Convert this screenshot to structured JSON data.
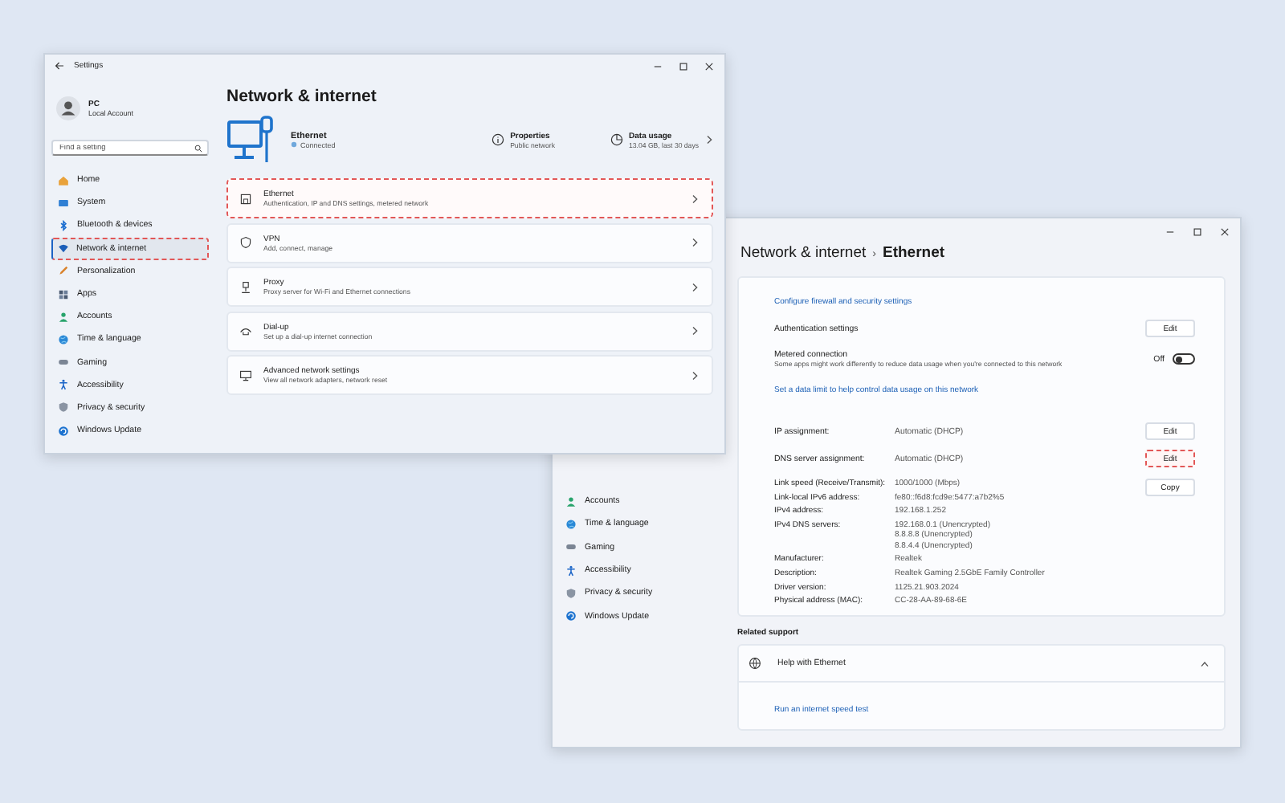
{
  "settings_window": {
    "title": "Settings",
    "user": {
      "name": "PC",
      "account": "Local Account"
    },
    "search": {
      "placeholder": "Find a setting"
    },
    "nav": [
      {
        "label": "Home",
        "selected": false,
        "highlighted": false
      },
      {
        "label": "System",
        "selected": false,
        "highlighted": false
      },
      {
        "label": "Bluetooth & devices",
        "selected": false,
        "highlighted": false
      },
      {
        "label": "Network & internet",
        "selected": true,
        "highlighted": true
      },
      {
        "label": "Personalization",
        "selected": false,
        "highlighted": false
      },
      {
        "label": "Apps",
        "selected": false,
        "highlighted": false
      },
      {
        "label": "Accounts",
        "selected": false,
        "highlighted": false
      },
      {
        "label": "Time & language",
        "selected": false,
        "highlighted": false
      },
      {
        "label": "Gaming",
        "selected": false,
        "highlighted": false
      },
      {
        "label": "Accessibility",
        "selected": false,
        "highlighted": false
      },
      {
        "label": "Privacy & security",
        "selected": false,
        "highlighted": false
      },
      {
        "label": "Windows Update",
        "selected": false,
        "highlighted": false
      }
    ],
    "heading": "Network & internet",
    "connection": {
      "name": "Ethernet",
      "state": "Connected"
    },
    "properties": {
      "title": "Properties",
      "value": "Public network"
    },
    "data_usage": {
      "title": "Data usage",
      "value": "13.04 GB, last 30 days"
    },
    "items": [
      {
        "title": "Ethernet",
        "subtitle": "Authentication, IP and DNS settings, metered network",
        "highlighted": true
      },
      {
        "title": "VPN",
        "subtitle": "Add, connect, manage",
        "highlighted": false
      },
      {
        "title": "Proxy",
        "subtitle": "Proxy server for Wi-Fi and Ethernet connections",
        "highlighted": false
      },
      {
        "title": "Dial-up",
        "subtitle": "Set up a dial-up internet connection",
        "highlighted": false
      },
      {
        "title": "Advanced network settings",
        "subtitle": "View all network adapters, network reset",
        "highlighted": false
      }
    ]
  },
  "ethernet_window": {
    "breadcrumb": {
      "parent": "Network & internet",
      "separator": "›",
      "current": "Ethernet"
    },
    "nav": [
      {
        "label": "Accounts",
        "selected": false
      },
      {
        "label": "Time & language",
        "selected": false
      },
      {
        "label": "Gaming",
        "selected": false
      },
      {
        "label": "Accessibility",
        "selected": false
      },
      {
        "label": "Privacy & security",
        "selected": false
      },
      {
        "label": "Windows Update",
        "selected": false
      }
    ],
    "rows": [
      {
        "kind": "link",
        "text": "Configure firewall and security settings"
      },
      {
        "kind": "button",
        "label": "Authentication settings",
        "button": "Edit",
        "highlighted": false
      },
      {
        "kind": "toggle",
        "label": "Metered connection",
        "description": "Some apps might work differently to reduce data usage when you're connected to this network",
        "state_text": "Off",
        "on": false
      },
      {
        "kind": "link",
        "text": "Set a data limit to help control data usage on this network"
      },
      {
        "kind": "value",
        "label": "IP assignment:",
        "value": "Automatic (DHCP)",
        "button": "Edit",
        "highlighted": false
      },
      {
        "kind": "value",
        "label": "DNS server assignment:",
        "value": "Automatic (DHCP)",
        "button": "Edit",
        "highlighted": true
      }
    ],
    "copy_button": "Copy",
    "details": [
      {
        "label": "Link speed (Receive/Transmit):",
        "values": [
          "1000/1000 (Mbps)"
        ]
      },
      {
        "label": "Link-local IPv6 address:",
        "values": [
          "fe80::f6d8:fcd9e:5477:a7b2%5"
        ]
      },
      {
        "label": "IPv4 address:",
        "values": [
          "192.168.1.252"
        ]
      },
      {
        "label": "IPv4 DNS servers:",
        "values": [
          "192.168.0.1 (Unencrypted)",
          "8.8.8.8 (Unencrypted)",
          "8.8.4.4 (Unencrypted)"
        ]
      },
      {
        "label": "Manufacturer:",
        "values": [
          "Realtek"
        ]
      },
      {
        "label": "Description:",
        "values": [
          "Realtek Gaming 2.5GbE Family Controller"
        ]
      },
      {
        "label": "Driver version:",
        "values": [
          "1125.21.903.2024"
        ]
      },
      {
        "label": "Physical address (MAC):",
        "values": [
          "CC-28-AA-89-68-6E"
        ]
      }
    ],
    "related_support": {
      "heading": "Related support",
      "help_title": "Help with Ethernet",
      "expanded": true,
      "link": "Run an internet speed test"
    }
  }
}
